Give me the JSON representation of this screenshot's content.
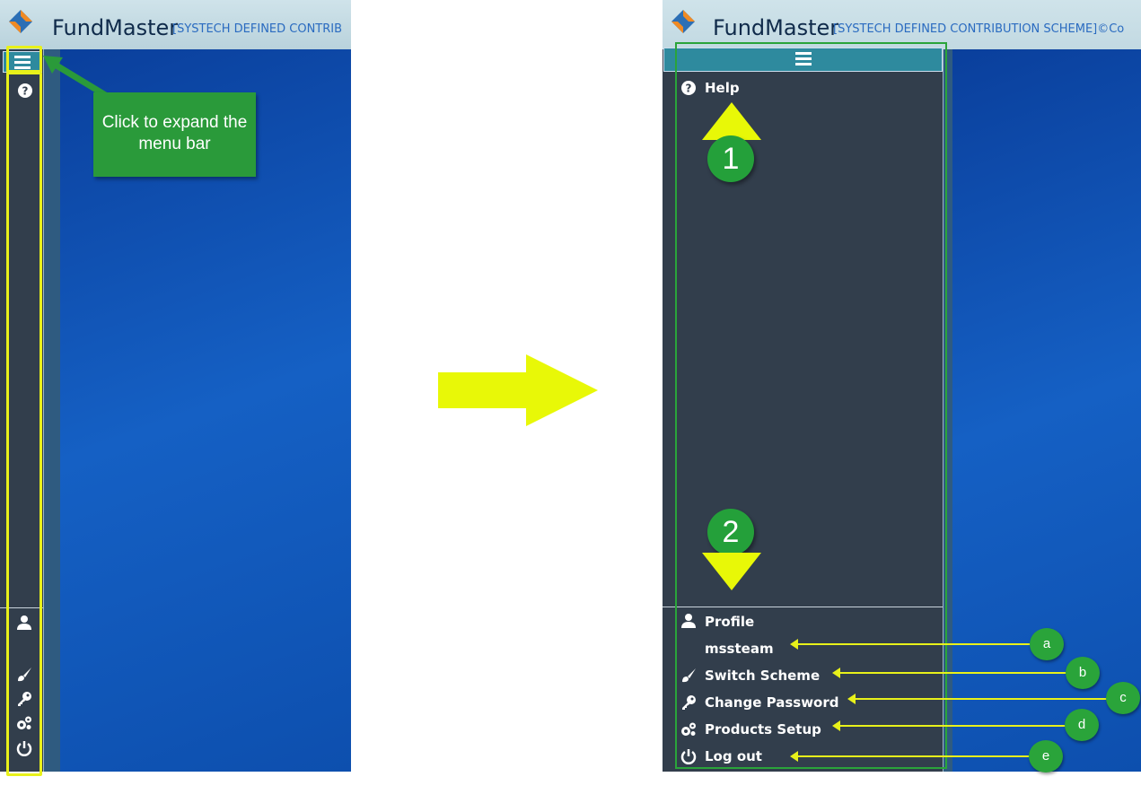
{
  "app": {
    "brand": "FundMaster",
    "scheme_left": "[SYSTECH DEFINED CONTRIB",
    "scheme_right": "[SYSTECH DEFINED CONTRIBUTION SCHEME]©Co"
  },
  "menu": {
    "help": "Help",
    "profile": "Profile",
    "username": "mssteam",
    "switch_scheme": "Switch Scheme",
    "change_password": "Change Password",
    "products_setup": "Products Setup",
    "log_out": "Log out"
  },
  "annotations": {
    "callout": "Click to expand the menu bar",
    "step1": "1",
    "step2": "2",
    "a": "a",
    "b": "b",
    "c": "c",
    "d": "d",
    "e": "e"
  },
  "colors": {
    "sidebar": "#323e4c",
    "content": "#1560c4",
    "annotation_yellow": "#e8f11a",
    "annotation_green": "#2aa43a"
  }
}
